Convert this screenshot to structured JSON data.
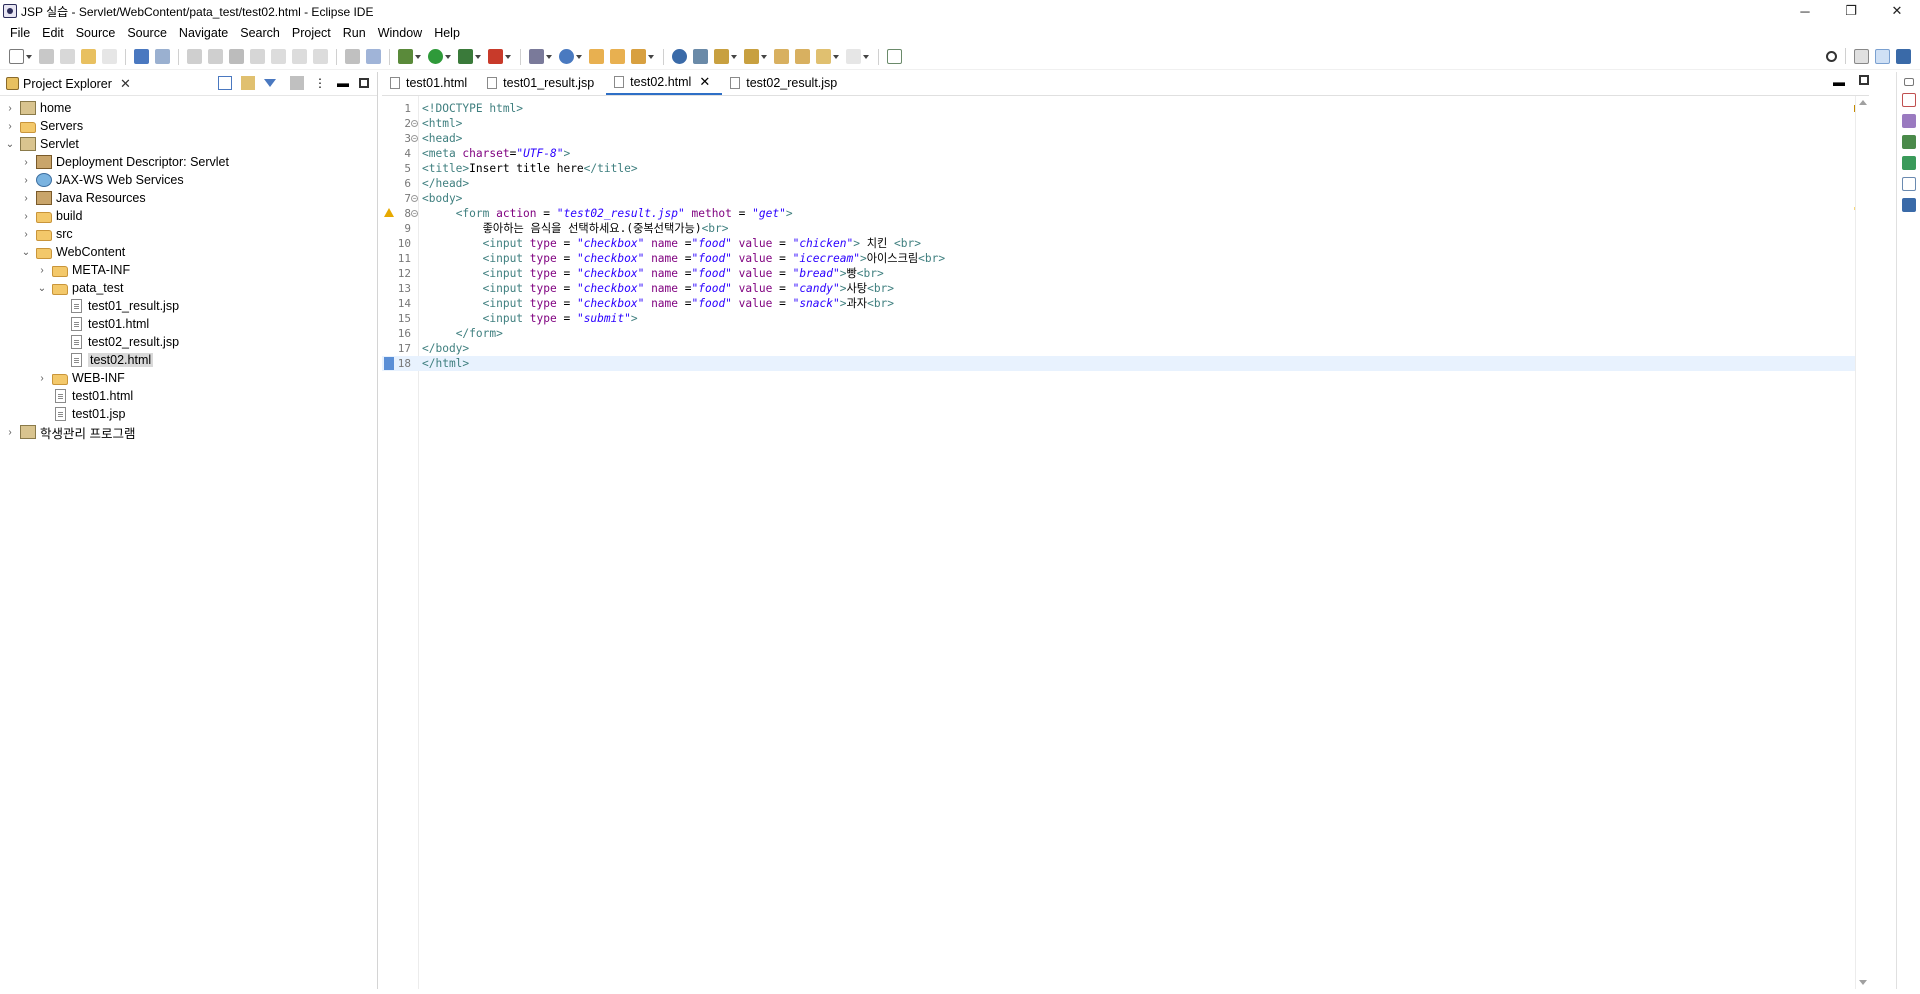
{
  "window": {
    "title": "JSP 실습 - Servlet/WebContent/pata_test/test02.html - Eclipse IDE",
    "minimize": "─",
    "maximize": "❐",
    "close": "✕"
  },
  "menu": [
    "File",
    "Edit",
    "Source",
    "Source",
    "Navigate",
    "Search",
    "Project",
    "Run",
    "Window",
    "Help"
  ],
  "explorer": {
    "tab_label": "Project Explorer",
    "tree": [
      {
        "label": "home",
        "depth": 0,
        "toggle": "›",
        "icon": "project"
      },
      {
        "label": "Servers",
        "depth": 0,
        "toggle": "›",
        "icon": "folder"
      },
      {
        "label": "Servlet",
        "depth": 0,
        "toggle": "⌄",
        "icon": "project"
      },
      {
        "label": "Deployment Descriptor: Servlet",
        "depth": 1,
        "toggle": "›",
        "icon": "pkg"
      },
      {
        "label": "JAX-WS Web Services",
        "depth": 1,
        "toggle": "›",
        "icon": "ws"
      },
      {
        "label": "Java Resources",
        "depth": 1,
        "toggle": "›",
        "icon": "pkg"
      },
      {
        "label": "build",
        "depth": 1,
        "toggle": "›",
        "icon": "folder"
      },
      {
        "label": "src",
        "depth": 1,
        "toggle": "›",
        "icon": "folder"
      },
      {
        "label": "WebContent",
        "depth": 1,
        "toggle": "⌄",
        "icon": "folder"
      },
      {
        "label": "META-INF",
        "depth": 2,
        "toggle": "›",
        "icon": "folder"
      },
      {
        "label": "pata_test",
        "depth": 2,
        "toggle": "⌄",
        "icon": "folder"
      },
      {
        "label": "test01_result.jsp",
        "depth": 3,
        "toggle": "",
        "icon": "file"
      },
      {
        "label": "test01.html",
        "depth": 3,
        "toggle": "",
        "icon": "file"
      },
      {
        "label": "test02_result.jsp",
        "depth": 3,
        "toggle": "",
        "icon": "file"
      },
      {
        "label": "test02.html",
        "depth": 3,
        "toggle": "",
        "icon": "file",
        "selected": true
      },
      {
        "label": "WEB-INF",
        "depth": 2,
        "toggle": "›",
        "icon": "folder"
      },
      {
        "label": "test01.html",
        "depth": 2,
        "toggle": "",
        "icon": "file"
      },
      {
        "label": "test01.jsp",
        "depth": 2,
        "toggle": "",
        "icon": "file"
      },
      {
        "label": "학생관리 프로그램",
        "depth": 0,
        "toggle": "›",
        "icon": "project"
      }
    ]
  },
  "editor": {
    "tabs": [
      {
        "label": "test01.html",
        "active": false
      },
      {
        "label": "test01_result.jsp",
        "active": false
      },
      {
        "label": "test02.html",
        "active": true
      },
      {
        "label": "test02_result.jsp",
        "active": false
      }
    ],
    "lines": [
      {
        "n": "1",
        "fold": false,
        "marker": "",
        "parts": [
          [
            "tag",
            "<!DOCTYPE html>"
          ]
        ]
      },
      {
        "n": "2",
        "fold": true,
        "marker": "",
        "parts": [
          [
            "tag",
            "<html>"
          ]
        ]
      },
      {
        "n": "3",
        "fold": true,
        "marker": "",
        "parts": [
          [
            "tag",
            "<head>"
          ]
        ]
      },
      {
        "n": "4",
        "fold": false,
        "marker": "",
        "parts": [
          [
            "tag",
            "<meta "
          ],
          [
            "attr",
            "charset"
          ],
          [
            "ktext",
            "="
          ],
          [
            "val",
            "\"UTF-8\""
          ],
          [
            "tag",
            ">"
          ]
        ]
      },
      {
        "n": "5",
        "fold": false,
        "marker": "",
        "parts": [
          [
            "tag",
            "<title>"
          ],
          [
            "ktext",
            "Insert title here"
          ],
          [
            "tag",
            "</title>"
          ]
        ]
      },
      {
        "n": "6",
        "fold": false,
        "marker": "",
        "parts": [
          [
            "tag",
            "</head>"
          ]
        ]
      },
      {
        "n": "7",
        "fold": true,
        "marker": "",
        "parts": [
          [
            "tag",
            "<body>"
          ]
        ]
      },
      {
        "n": "8",
        "fold": true,
        "marker": "warning",
        "parts": [
          [
            "ktext",
            "     "
          ],
          [
            "tag",
            "<form "
          ],
          [
            "attr",
            "action"
          ],
          [
            "ktext",
            " = "
          ],
          [
            "val",
            "\"test02_result.jsp\""
          ],
          [
            "ktext",
            " "
          ],
          [
            "attr",
            "methot"
          ],
          [
            "ktext",
            " = "
          ],
          [
            "val",
            "\"get\""
          ],
          [
            "tag",
            ">"
          ]
        ]
      },
      {
        "n": "9",
        "fold": false,
        "marker": "",
        "parts": [
          [
            "ktext",
            "         좋아하는 음식을 선택하세요.(중복선택가능)"
          ],
          [
            "tag",
            "<br>"
          ]
        ]
      },
      {
        "n": "10",
        "fold": false,
        "marker": "",
        "parts": [
          [
            "ktext",
            "         "
          ],
          [
            "tag",
            "<input "
          ],
          [
            "attr",
            "type"
          ],
          [
            "ktext",
            " = "
          ],
          [
            "val",
            "\"checkbox\""
          ],
          [
            "ktext",
            " "
          ],
          [
            "attr",
            "name"
          ],
          [
            "ktext",
            " ="
          ],
          [
            "val",
            "\"food\""
          ],
          [
            "ktext",
            " "
          ],
          [
            "attr",
            "value"
          ],
          [
            "ktext",
            " = "
          ],
          [
            "val",
            "\"chicken\""
          ],
          [
            "tag",
            ">"
          ],
          [
            "ktext",
            " 치킨 "
          ],
          [
            "tag",
            "<br>"
          ]
        ]
      },
      {
        "n": "11",
        "fold": false,
        "marker": "",
        "parts": [
          [
            "ktext",
            "         "
          ],
          [
            "tag",
            "<input "
          ],
          [
            "attr",
            "type"
          ],
          [
            "ktext",
            " = "
          ],
          [
            "val",
            "\"checkbox\""
          ],
          [
            "ktext",
            " "
          ],
          [
            "attr",
            "name"
          ],
          [
            "ktext",
            " ="
          ],
          [
            "val",
            "\"food\""
          ],
          [
            "ktext",
            " "
          ],
          [
            "attr",
            "value"
          ],
          [
            "ktext",
            " = "
          ],
          [
            "val",
            "\"icecream\""
          ],
          [
            "tag",
            ">"
          ],
          [
            "ktext",
            "아이스크림"
          ],
          [
            "tag",
            "<br>"
          ]
        ]
      },
      {
        "n": "12",
        "fold": false,
        "marker": "",
        "parts": [
          [
            "ktext",
            "         "
          ],
          [
            "tag",
            "<input "
          ],
          [
            "attr",
            "type"
          ],
          [
            "ktext",
            " = "
          ],
          [
            "val",
            "\"checkbox\""
          ],
          [
            "ktext",
            " "
          ],
          [
            "attr",
            "name"
          ],
          [
            "ktext",
            " ="
          ],
          [
            "val",
            "\"food\""
          ],
          [
            "ktext",
            " "
          ],
          [
            "attr",
            "value"
          ],
          [
            "ktext",
            " = "
          ],
          [
            "val",
            "\"bread\""
          ],
          [
            "tag",
            ">"
          ],
          [
            "ktext",
            "빵"
          ],
          [
            "tag",
            "<br>"
          ]
        ]
      },
      {
        "n": "13",
        "fold": false,
        "marker": "",
        "parts": [
          [
            "ktext",
            "         "
          ],
          [
            "tag",
            "<input "
          ],
          [
            "attr",
            "type"
          ],
          [
            "ktext",
            " = "
          ],
          [
            "val",
            "\"checkbox\""
          ],
          [
            "ktext",
            " "
          ],
          [
            "attr",
            "name"
          ],
          [
            "ktext",
            " ="
          ],
          [
            "val",
            "\"food\""
          ],
          [
            "ktext",
            " "
          ],
          [
            "attr",
            "value"
          ],
          [
            "ktext",
            " = "
          ],
          [
            "val",
            "\"candy\""
          ],
          [
            "tag",
            ">"
          ],
          [
            "ktext",
            "사탕"
          ],
          [
            "tag",
            "<br>"
          ]
        ]
      },
      {
        "n": "14",
        "fold": false,
        "marker": "",
        "parts": [
          [
            "ktext",
            "         "
          ],
          [
            "tag",
            "<input "
          ],
          [
            "attr",
            "type"
          ],
          [
            "ktext",
            " = "
          ],
          [
            "val",
            "\"checkbox\""
          ],
          [
            "ktext",
            " "
          ],
          [
            "attr",
            "name"
          ],
          [
            "ktext",
            " ="
          ],
          [
            "val",
            "\"food\""
          ],
          [
            "ktext",
            " "
          ],
          [
            "attr",
            "value"
          ],
          [
            "ktext",
            " = "
          ],
          [
            "val",
            "\"snack\""
          ],
          [
            "tag",
            ">"
          ],
          [
            "ktext",
            "과자"
          ],
          [
            "tag",
            "<br>"
          ]
        ]
      },
      {
        "n": "15",
        "fold": false,
        "marker": "",
        "parts": [
          [
            "ktext",
            "         "
          ],
          [
            "tag",
            "<input "
          ],
          [
            "attr",
            "type"
          ],
          [
            "ktext",
            " = "
          ],
          [
            "val",
            "\"submit\""
          ],
          [
            "tag",
            ">"
          ]
        ]
      },
      {
        "n": "16",
        "fold": false,
        "marker": "",
        "parts": [
          [
            "ktext",
            "     "
          ],
          [
            "tag",
            "</form>"
          ]
        ]
      },
      {
        "n": "17",
        "fold": false,
        "marker": "",
        "parts": [
          [
            "tag",
            "</body>"
          ]
        ]
      },
      {
        "n": "18",
        "fold": false,
        "marker": "bookmark",
        "current": true,
        "parts": [
          [
            "tag",
            "</html>"
          ]
        ]
      }
    ]
  },
  "colors": {
    "tag": "#3f7f7f",
    "attribute": "#7f007f",
    "value": "#2a00ff",
    "active_tab_underline": "#2e6fc6",
    "current_line": "#e8f2fe"
  }
}
